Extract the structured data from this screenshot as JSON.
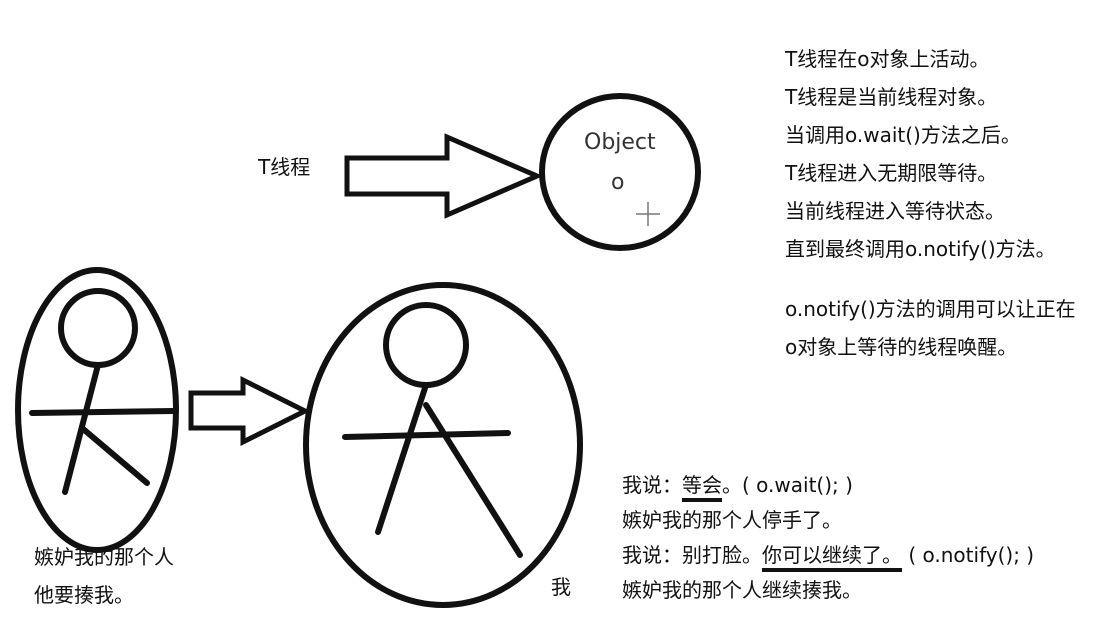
{
  "top_diagram": {
    "thread_label": "T线程",
    "object_label": "Object",
    "object_var": "o"
  },
  "notes": {
    "block1": [
      "T线程在o对象上活动。",
      "T线程是当前线程对象。",
      "当调用o.wait()方法之后。",
      "T线程进入无期限等待。",
      "当前线程进入等待状态。",
      "直到最终调用o.notify()方法。"
    ],
    "block2": [
      "o.notify()方法的调用可以让正在",
      "o对象上等待的线程唤醒。"
    ]
  },
  "left_person": {
    "caption_line1": "嫉妒我的那个人",
    "caption_line2": "他要揍我。"
  },
  "right_person": {
    "caption": "我"
  },
  "dialog": {
    "line1_prefix": "我说：",
    "line1_underlined": "等会",
    "line1_suffix": "。( o.wait(); )",
    "line2": "嫉妒我的那个人停手了。",
    "line3_prefix": "我说：别打脸。",
    "line3_underlined": "你可以继续了。",
    "line3_suffix": " ( o.notify(); )",
    "line4": "嫉妒我的那个人继续揍我。"
  }
}
